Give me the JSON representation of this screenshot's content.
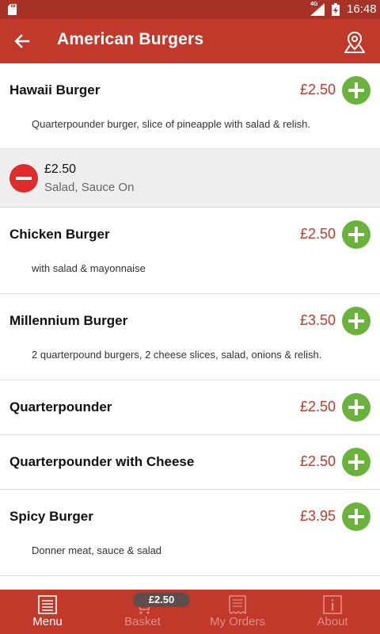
{
  "status_bar": {
    "network": "4G",
    "time": "16:48"
  },
  "app_bar": {
    "title": "American Burgers"
  },
  "menu": {
    "items": [
      {
        "name": "Hawaii Burger",
        "price": "£2.50",
        "description": "Quarterpounder burger, slice of pineapple with salad & relish."
      },
      {
        "name": "Chicken Burger",
        "price": "£2.50",
        "description": "with salad & mayonnaise"
      },
      {
        "name": "Millennium Burger",
        "price": "£3.50",
        "description": "2 quarterpound burgers, 2 cheese slices, salad, onions & relish."
      },
      {
        "name": "Quarterpounder",
        "price": "£2.50",
        "description": ""
      },
      {
        "name": "Quarterpounder with Cheese",
        "price": "£2.50",
        "description": ""
      },
      {
        "name": "Spicy Burger",
        "price": "£3.95",
        "description": "Donner meat, sauce & salad"
      }
    ],
    "selected_line": {
      "price": "£2.50",
      "options": "Salad, Sauce On"
    }
  },
  "bottom_nav": {
    "tabs": [
      {
        "label": "Menu",
        "icon": "menu-list-icon",
        "active": true
      },
      {
        "label": "Basket",
        "icon": "basket-icon",
        "active": false
      },
      {
        "label": "My Orders",
        "icon": "receipt-icon",
        "active": false
      },
      {
        "label": "About",
        "icon": "info-icon",
        "active": false
      }
    ],
    "basket_badge": "£2.50"
  },
  "colors": {
    "primary": "#c0392b",
    "status_bar": "#a83226",
    "price": "#c0392b",
    "add": "#6ab23b",
    "remove": "#e02b2b"
  }
}
